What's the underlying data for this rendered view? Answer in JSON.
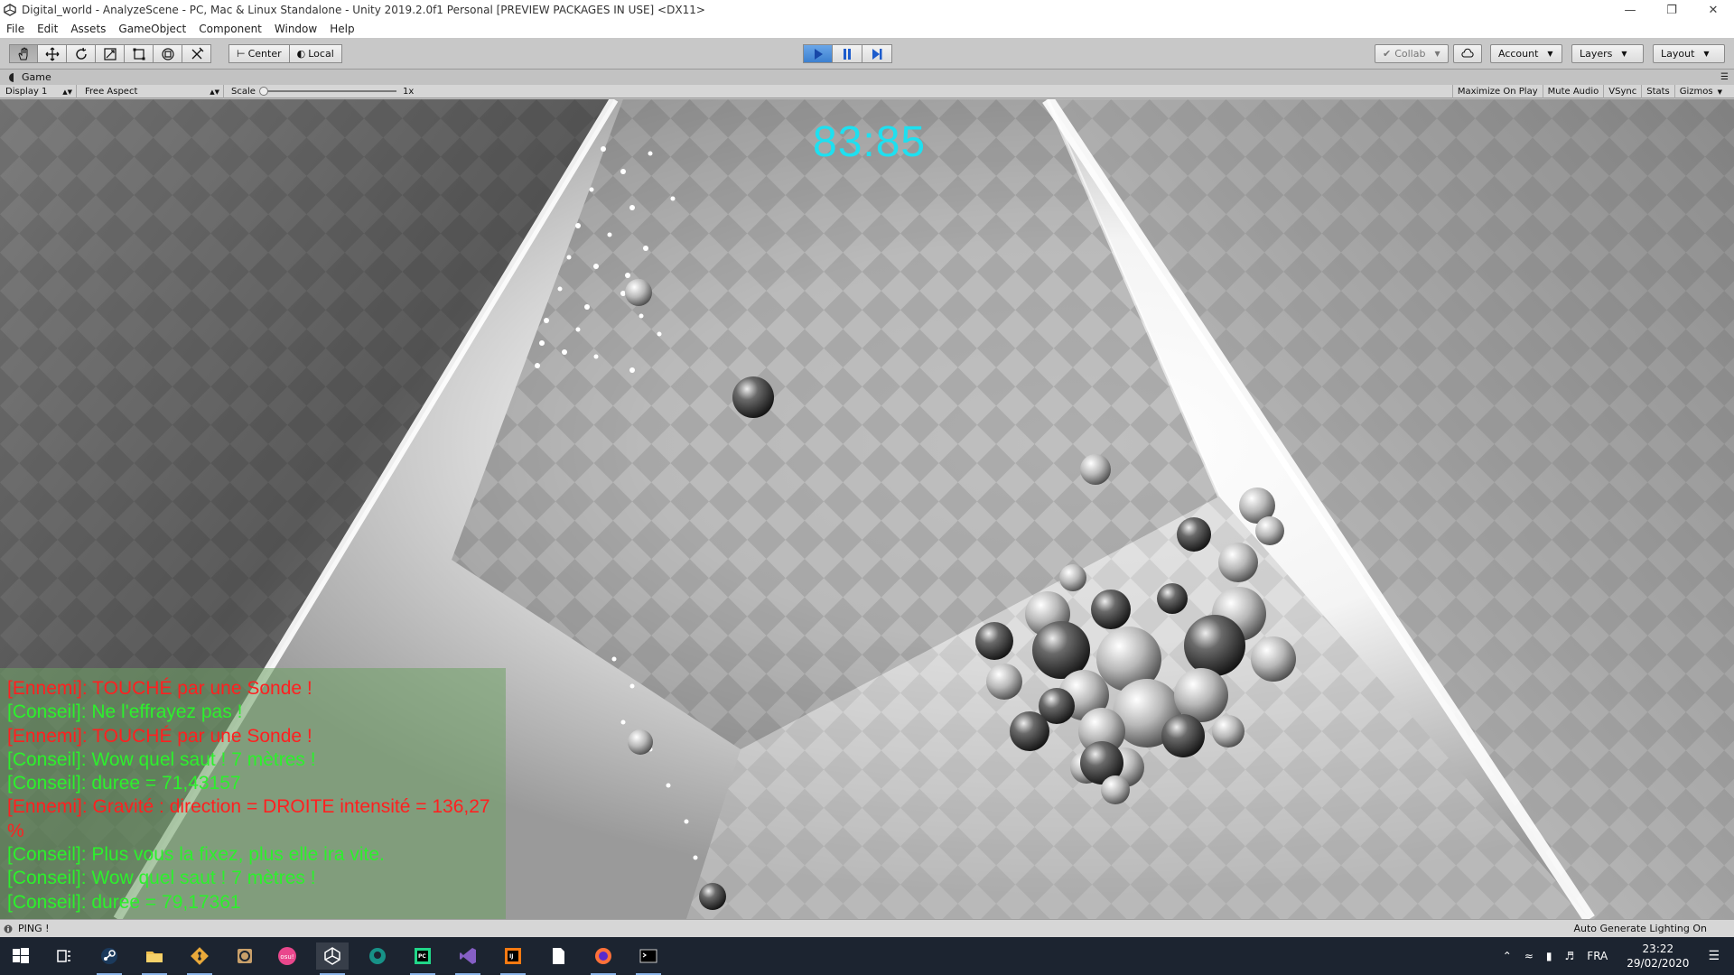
{
  "titlebar": {
    "title": "Digital_world - AnalyzeScene - PC, Mac & Linux Standalone - Unity 2019.2.0f1 Personal [PREVIEW PACKAGES IN USE] <DX11>"
  },
  "menu": [
    "File",
    "Edit",
    "Assets",
    "GameObject",
    "Component",
    "Window",
    "Help"
  ],
  "toolbar": {
    "tools": [
      "hand-tool-icon",
      "move-tool-icon",
      "rotate-tool-icon",
      "scale-tool-icon",
      "rect-tool-icon",
      "transform-tool-icon",
      "custom-tool-icon"
    ],
    "pivot_label": "Center",
    "space_label": "Local",
    "collab_label": "Collab",
    "account_label": "Account",
    "layers_label": "Layers",
    "layout_label": "Layout"
  },
  "game_tab": {
    "label": "Game"
  },
  "game_bar": {
    "display": "Display 1",
    "aspect": "Free Aspect",
    "scale_label": "Scale",
    "scale_value": "1x",
    "maximize": "Maximize On Play",
    "mute": "Mute Audio",
    "vsync": "VSync",
    "stats": "Stats",
    "gizmos": "Gizmos"
  },
  "game": {
    "timer": "83:85",
    "log": [
      {
        "type": "enemy",
        "text": "[Ennemi]: TOUCHÉ par une Sonde !"
      },
      {
        "type": "tip",
        "text": "[Conseil]: Ne l'effrayez pas !"
      },
      {
        "type": "enemy",
        "text": "[Ennemi]: TOUCHÉ par une Sonde !"
      },
      {
        "type": "tip",
        "text": "[Conseil]: Wow quel saut ! 7 mètres !"
      },
      {
        "type": "tip",
        "text": "[Conseil]: duree = 71,43157"
      },
      {
        "type": "enemy",
        "text": "[Ennemi]: Gravité : direction = DROITE intensité = 136,27"
      },
      {
        "type": "enemy",
        "text": "%"
      },
      {
        "type": "tip",
        "text": "[Conseil]: Plus vous la fixez, plus elle ira vite."
      },
      {
        "type": "tip",
        "text": "[Conseil]: Wow quel saut ! 7 mètres !"
      },
      {
        "type": "tip",
        "text": "[Conseil]: duree = 79,17361"
      }
    ]
  },
  "statusbar": {
    "message": "PING !",
    "lighting": "Auto Generate Lighting On"
  },
  "taskbar": {
    "apps": [
      "windows-start-icon",
      "task-view-icon",
      "steam-icon",
      "file-explorer-icon",
      "git-icon",
      "blender-icon",
      "osu-icon",
      "unity-icon",
      "gitkraken-icon",
      "pycharm-icon",
      "visual-studio-icon",
      "intellij-icon",
      "file-icon",
      "firefox-icon",
      "terminal-icon"
    ],
    "language": "FRA",
    "time": "23:22",
    "date": "29/02/2020"
  },
  "colors": {
    "timer": "#1ee0f0",
    "enemy": "#ff2020",
    "tip": "#2cf02c",
    "play_active": "#3c80d0"
  }
}
